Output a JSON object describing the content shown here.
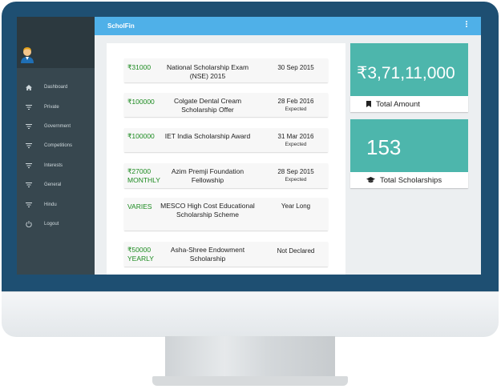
{
  "app": {
    "title": "ScholFin"
  },
  "sidebar": {
    "items": [
      {
        "label": "Dashboard",
        "icon": "home-icon"
      },
      {
        "label": "Private",
        "icon": "filter-icon"
      },
      {
        "label": "Government",
        "icon": "filter-icon"
      },
      {
        "label": "Competitions",
        "icon": "filter-icon"
      },
      {
        "label": "Interests",
        "icon": "filter-icon"
      },
      {
        "label": "General",
        "icon": "filter-icon"
      },
      {
        "label": "Hindu",
        "icon": "filter-icon"
      },
      {
        "label": "Logout",
        "icon": "power-icon"
      }
    ]
  },
  "scholarships": [
    {
      "amount": "₹31000",
      "name": "National Scholarship Exam (NSE) 2015",
      "date": "30 Sep 2015",
      "status": ""
    },
    {
      "amount": "₹100000",
      "name": "Colgate Dental Cream Scholarship Offer",
      "date": "28 Feb 2016",
      "status": "Expected"
    },
    {
      "amount": "₹100000",
      "name": "IET India Scholarship Award",
      "date": "31 Mar 2016",
      "status": "Expected"
    },
    {
      "amount": "₹27000 MONTHLY",
      "name": "Azim Premji Foundation Fellowship",
      "date": "28 Sep 2015",
      "status": "Expected"
    },
    {
      "amount": "VARIES",
      "name": "MESCO High Cost Educational Scholarship Scheme",
      "date": "Year Long",
      "status": ""
    },
    {
      "amount": "₹50000 YEARLY",
      "name": "Asha-Shree Endowment Scholarship",
      "date": "Not Declared",
      "status": ""
    }
  ],
  "stats": {
    "total_amount": {
      "value": "₹3,71,11,000",
      "label": "Total Amount",
      "icon": "bookmark-icon"
    },
    "total_scholarships": {
      "value": "153",
      "label": "Total Scholarships",
      "icon": "graduation-cap-icon"
    }
  },
  "colors": {
    "accent": "#4fb0e8",
    "stat": "#4db6ac",
    "amount": "#1b8a1f",
    "sidebar": "#37474f",
    "bezel": "#1e4f72"
  }
}
